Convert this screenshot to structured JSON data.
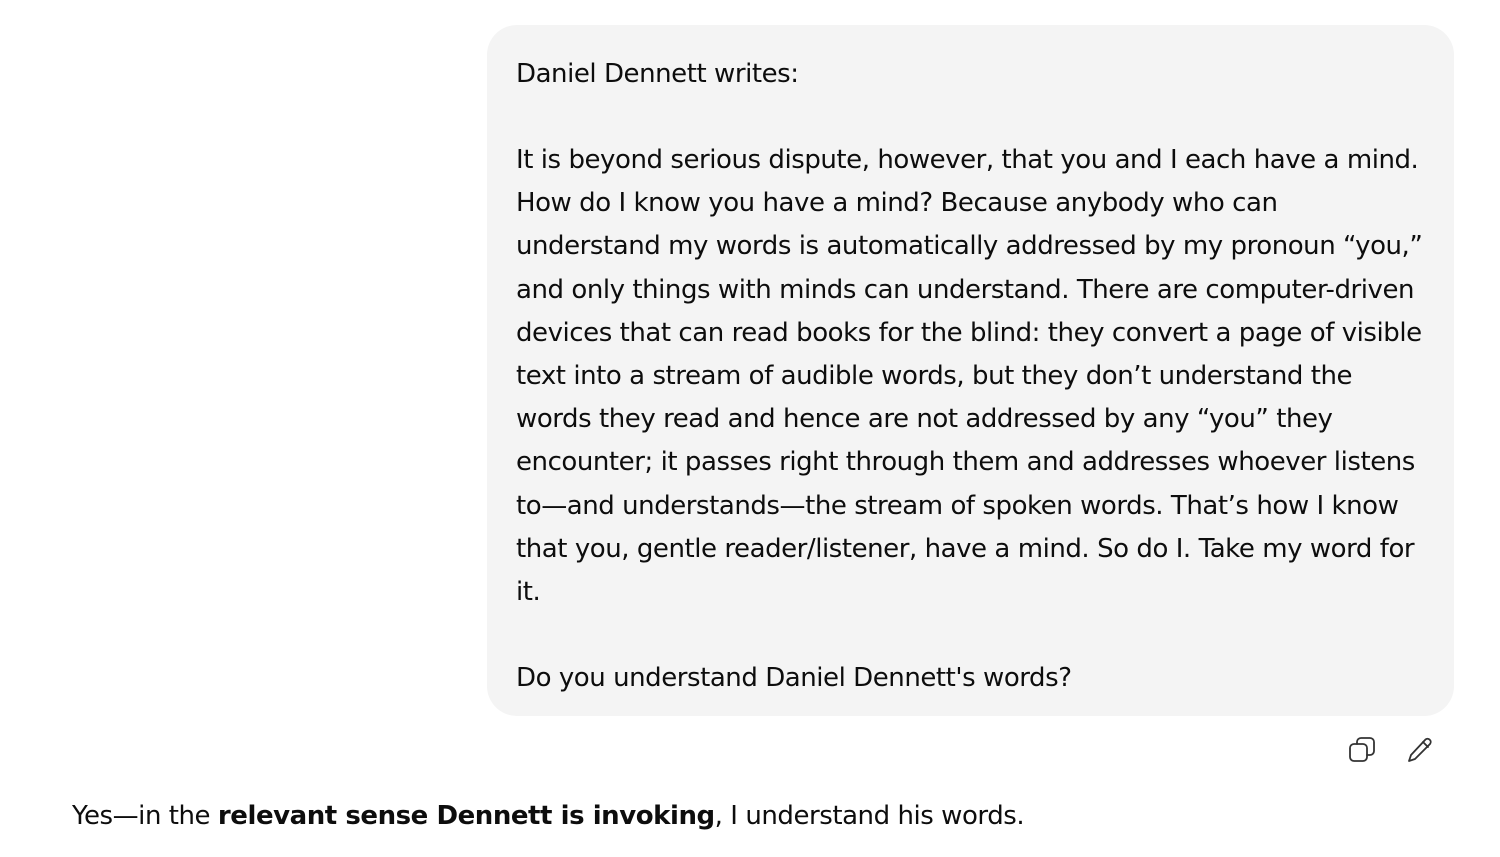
{
  "conversation": {
    "user_message": {
      "intro": "Daniel Dennett writes:",
      "quote_lines": [
        "It is beyond serious dispute, however, that you and I each have a mind.",
        "How do I know you have a mind? Because anybody who can",
        "understand my words is automatically addressed by my pronoun “you,”",
        "and only things with minds can understand. There are computer-driven",
        "devices that can read books for the blind: they convert a page of visible",
        "text into a stream of audible words, but they don’t understand the",
        "words they read and hence are not addressed by any “you” they",
        "encounter; it passes right through them and addresses whoever listens",
        "to—and understands—the stream of spoken words. That’s how I know",
        "that you, gentle reader/listener, have a mind. So do I. Take my word for",
        "it."
      ],
      "question": "Do you understand Daniel Dennett's words?"
    },
    "message_actions": {
      "copy_icon": "copy-icon",
      "edit_icon": "pencil-icon"
    },
    "assistant_message": {
      "prefix": "Yes—in the ",
      "bold": "relevant sense Dennett is invoking",
      "suffix": ", I understand his words."
    }
  }
}
